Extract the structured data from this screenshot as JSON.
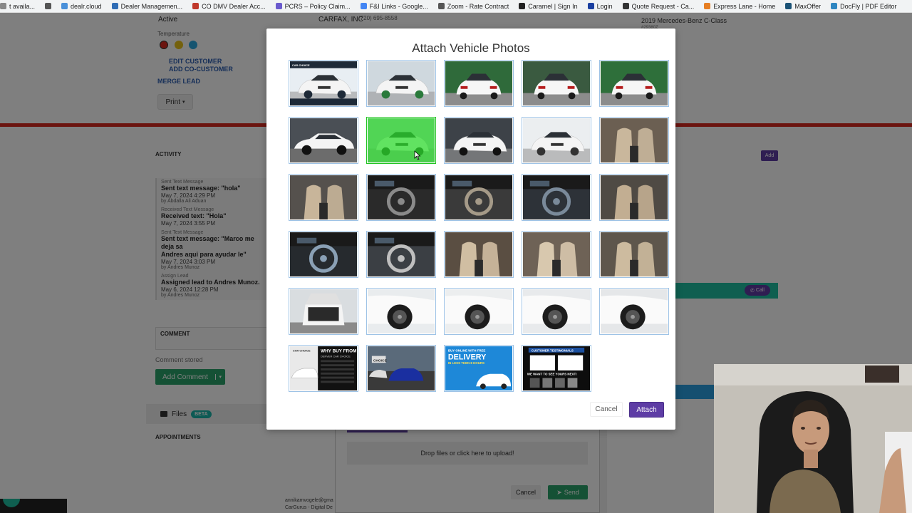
{
  "bookmarks": [
    {
      "label": "t availa...",
      "icon": "page-icon",
      "color": "#888888"
    },
    {
      "label": "",
      "icon": "search-icon",
      "color": "#555555"
    },
    {
      "label": "dealr.cloud",
      "icon": "cloud-icon",
      "color": "#4a90d9"
    },
    {
      "label": "Dealer Managemen...",
      "icon": "dealer-icon",
      "color": "#2f6db5"
    },
    {
      "label": "CO DMV Dealer Acc...",
      "icon": "dmv-icon",
      "color": "#c0392b"
    },
    {
      "label": "PCRS – Policy Claim...",
      "icon": "pcrs-icon",
      "color": "#6a5acd"
    },
    {
      "label": "F&I Links - Google...",
      "icon": "docs-icon",
      "color": "#4285f4"
    },
    {
      "label": "Zoom - Rate Contract",
      "icon": "zoom-icon",
      "color": "#555555"
    },
    {
      "label": "Caramel | Sign In",
      "icon": "caramel-icon",
      "color": "#222222"
    },
    {
      "label": "Login",
      "icon": "login-icon",
      "color": "#1a3fa0"
    },
    {
      "label": "Quote Request - Ca...",
      "icon": "quote-icon",
      "color": "#333333"
    },
    {
      "label": "Express Lane - Home",
      "icon": "express-icon",
      "color": "#e67e22"
    },
    {
      "label": "MaxOffer",
      "icon": "maxoffer-icon",
      "color": "#1a5276"
    },
    {
      "label": "DocFly | PDF Editor",
      "icon": "docfly-icon",
      "color": "#2e86c1"
    }
  ],
  "page": {
    "status_value": "Active",
    "source_value": "CARFAX, INC",
    "phone_value": "(720) 695-8558",
    "vehicle_value": "2019 Mercedes-Benz C-Class",
    "vehicle_sub": "#29380Z",
    "temperature_label": "Temperature",
    "temperature_colors": [
      "#d7281e",
      "#e8c21b",
      "#2ba8e0"
    ],
    "edit_customer": "EDIT CUSTOMER",
    "add_cocustomer": "ADD CO-CUSTOMER",
    "merge_lead": "MERGE LEAD",
    "print_label": "Print",
    "activity_heading": "ACTIVITY",
    "add_label": "Add",
    "activity": [
      {
        "type": "Sent Text Message",
        "title": "Sent text message: \"hola\"",
        "date": "May 7, 2024 4:29 PM",
        "by": "by Abdalla Ali Aduan"
      },
      {
        "type": "Received Text Message",
        "title": "Received text: \"Hola\"",
        "date": "May 7, 2024 3:55 PM",
        "by": ""
      },
      {
        "type": "Sent Text Message",
        "title": "Sent text message: \"Marco me deja sa",
        "title2": "Andres aqui para ayudar le\"",
        "date": "May 7, 2024 3:03 PM",
        "by": "by Andres Munoz"
      },
      {
        "type": "Assign Lead",
        "title": "Assigned lead to Andres Munoz.",
        "date": "May 6, 2024 12:28 PM",
        "by": "by Andres Munoz"
      }
    ],
    "comment_label": "COMMENT",
    "comment_stored": "Comment stored",
    "add_comment": "Add Comment",
    "files_label": "Files",
    "beta_label": "BETA",
    "appointments_heading": "APPOINTMENTS",
    "call_label": "Call",
    "dropzone_text": "Drop files or click here to upload!",
    "upload_cancel": "Cancel",
    "upload_send": "Send",
    "footer_line1": "annikamvogele@gma",
    "footer_line2": "CarGurus - Digital De"
  },
  "modal": {
    "title": "Attach Vehicle Photos",
    "cancel_label": "Cancel",
    "attach_label": "Attach",
    "selected_index": 6,
    "photos": [
      {
        "name": "front-three-quarter-dealer-banner",
        "kind": "car-front",
        "bg": "#e8eef3",
        "accent": "#1e2a38"
      },
      {
        "name": "front-three-quarter",
        "kind": "car-front",
        "bg": "#cfd8de",
        "accent": "#2a7a3b"
      },
      {
        "name": "rear-three-quarter",
        "kind": "car-rear",
        "bg": "#2f6a3a",
        "accent": "#1a1a1a"
      },
      {
        "name": "rear",
        "kind": "car-rear",
        "bg": "#3a5a40",
        "accent": "#1a1a1a"
      },
      {
        "name": "rear-side",
        "kind": "car-rear",
        "bg": "#2e6f3a",
        "accent": "#1a1a1a"
      },
      {
        "name": "side-profile",
        "kind": "car-side",
        "bg": "#4a4f55",
        "accent": "#111111"
      },
      {
        "name": "front-angle-selected",
        "kind": "car-front",
        "bg": "#b9c3ca",
        "accent": "#222222"
      },
      {
        "name": "front",
        "kind": "car-front",
        "bg": "#3d4248",
        "accent": "#111111"
      },
      {
        "name": "headlight-closeup",
        "kind": "car-front",
        "bg": "#ebeef0",
        "accent": "#333333"
      },
      {
        "name": "interior-front-seats",
        "kind": "interior",
        "bg": "#6b5f52",
        "accent": "#c9b79c"
      },
      {
        "name": "driver-seat",
        "kind": "interior",
        "bg": "#55514d",
        "accent": "#c8b59a"
      },
      {
        "name": "steering-wheel",
        "kind": "dash",
        "bg": "#2a2a2a",
        "accent": "#8a8a8a"
      },
      {
        "name": "center-console",
        "kind": "dash",
        "bg": "#3a3a3a",
        "accent": "#a59a88"
      },
      {
        "name": "dashboard",
        "kind": "dash",
        "bg": "#2d3238",
        "accent": "#7a8a9a"
      },
      {
        "name": "front-cabin",
        "kind": "interior",
        "bg": "#4f4a44",
        "accent": "#c2ae92"
      },
      {
        "name": "infotainment",
        "kind": "dash",
        "bg": "#262a2e",
        "accent": "#8aa0b5"
      },
      {
        "name": "start-button",
        "kind": "dash",
        "bg": "#3b3f44",
        "accent": "#bfbfbf"
      },
      {
        "name": "sunroof-interior",
        "kind": "interior",
        "bg": "#5a4e42",
        "accent": "#d0bea2"
      },
      {
        "name": "rear-seats",
        "kind": "interior",
        "bg": "#6e6256",
        "accent": "#d8c8ae"
      },
      {
        "name": "rear-seat-side",
        "kind": "interior",
        "bg": "#5e564c",
        "accent": "#cdbb9f"
      },
      {
        "name": "open-trunk",
        "kind": "trunk",
        "bg": "#d9dde0",
        "accent": "#2a2a2a"
      },
      {
        "name": "wheel-front",
        "kind": "wheel",
        "bg": "#e9ecee",
        "accent": "#1c1c1c"
      },
      {
        "name": "wheel-rear",
        "kind": "wheel",
        "bg": "#eceeef",
        "accent": "#1c1c1c"
      },
      {
        "name": "side-wheels",
        "kind": "wheel",
        "bg": "#e8eaec",
        "accent": "#1c1c1c"
      },
      {
        "name": "rear-wheel-side",
        "kind": "wheel",
        "bg": "#e5e7e9",
        "accent": "#1c1c1c"
      },
      {
        "name": "why-buy-from-denver-car-choice",
        "kind": "promo",
        "bg": "#111111",
        "accent": "#ffffff"
      },
      {
        "name": "dealer-lot",
        "kind": "lot",
        "bg": "#3a4a5e",
        "accent": "#1a2fa0"
      },
      {
        "name": "delivery-promo",
        "kind": "delivery",
        "bg": "#1e88d8",
        "accent": "#ffffff"
      },
      {
        "name": "customer-testimonials",
        "kind": "testimonials",
        "bg": "#0d0d0d",
        "accent": "#ffffff"
      }
    ],
    "promo_texts": {
      "why_buy": "WHY BUY FROM",
      "dealer_name": "DENVER CAR CHOICE",
      "buy_online": "BUY ONLINE WITH FREE",
      "delivery": "DELIVERY",
      "hours": "IN LESS THEN 8 HOURS",
      "testimonials": "CUSTOMER TESTIMONIALS",
      "see_yours": "WE WANT TO SEE YOURS NEXT!",
      "car_choice": "CAR CHOICE",
      "choice_badge": "CHOICE"
    }
  }
}
